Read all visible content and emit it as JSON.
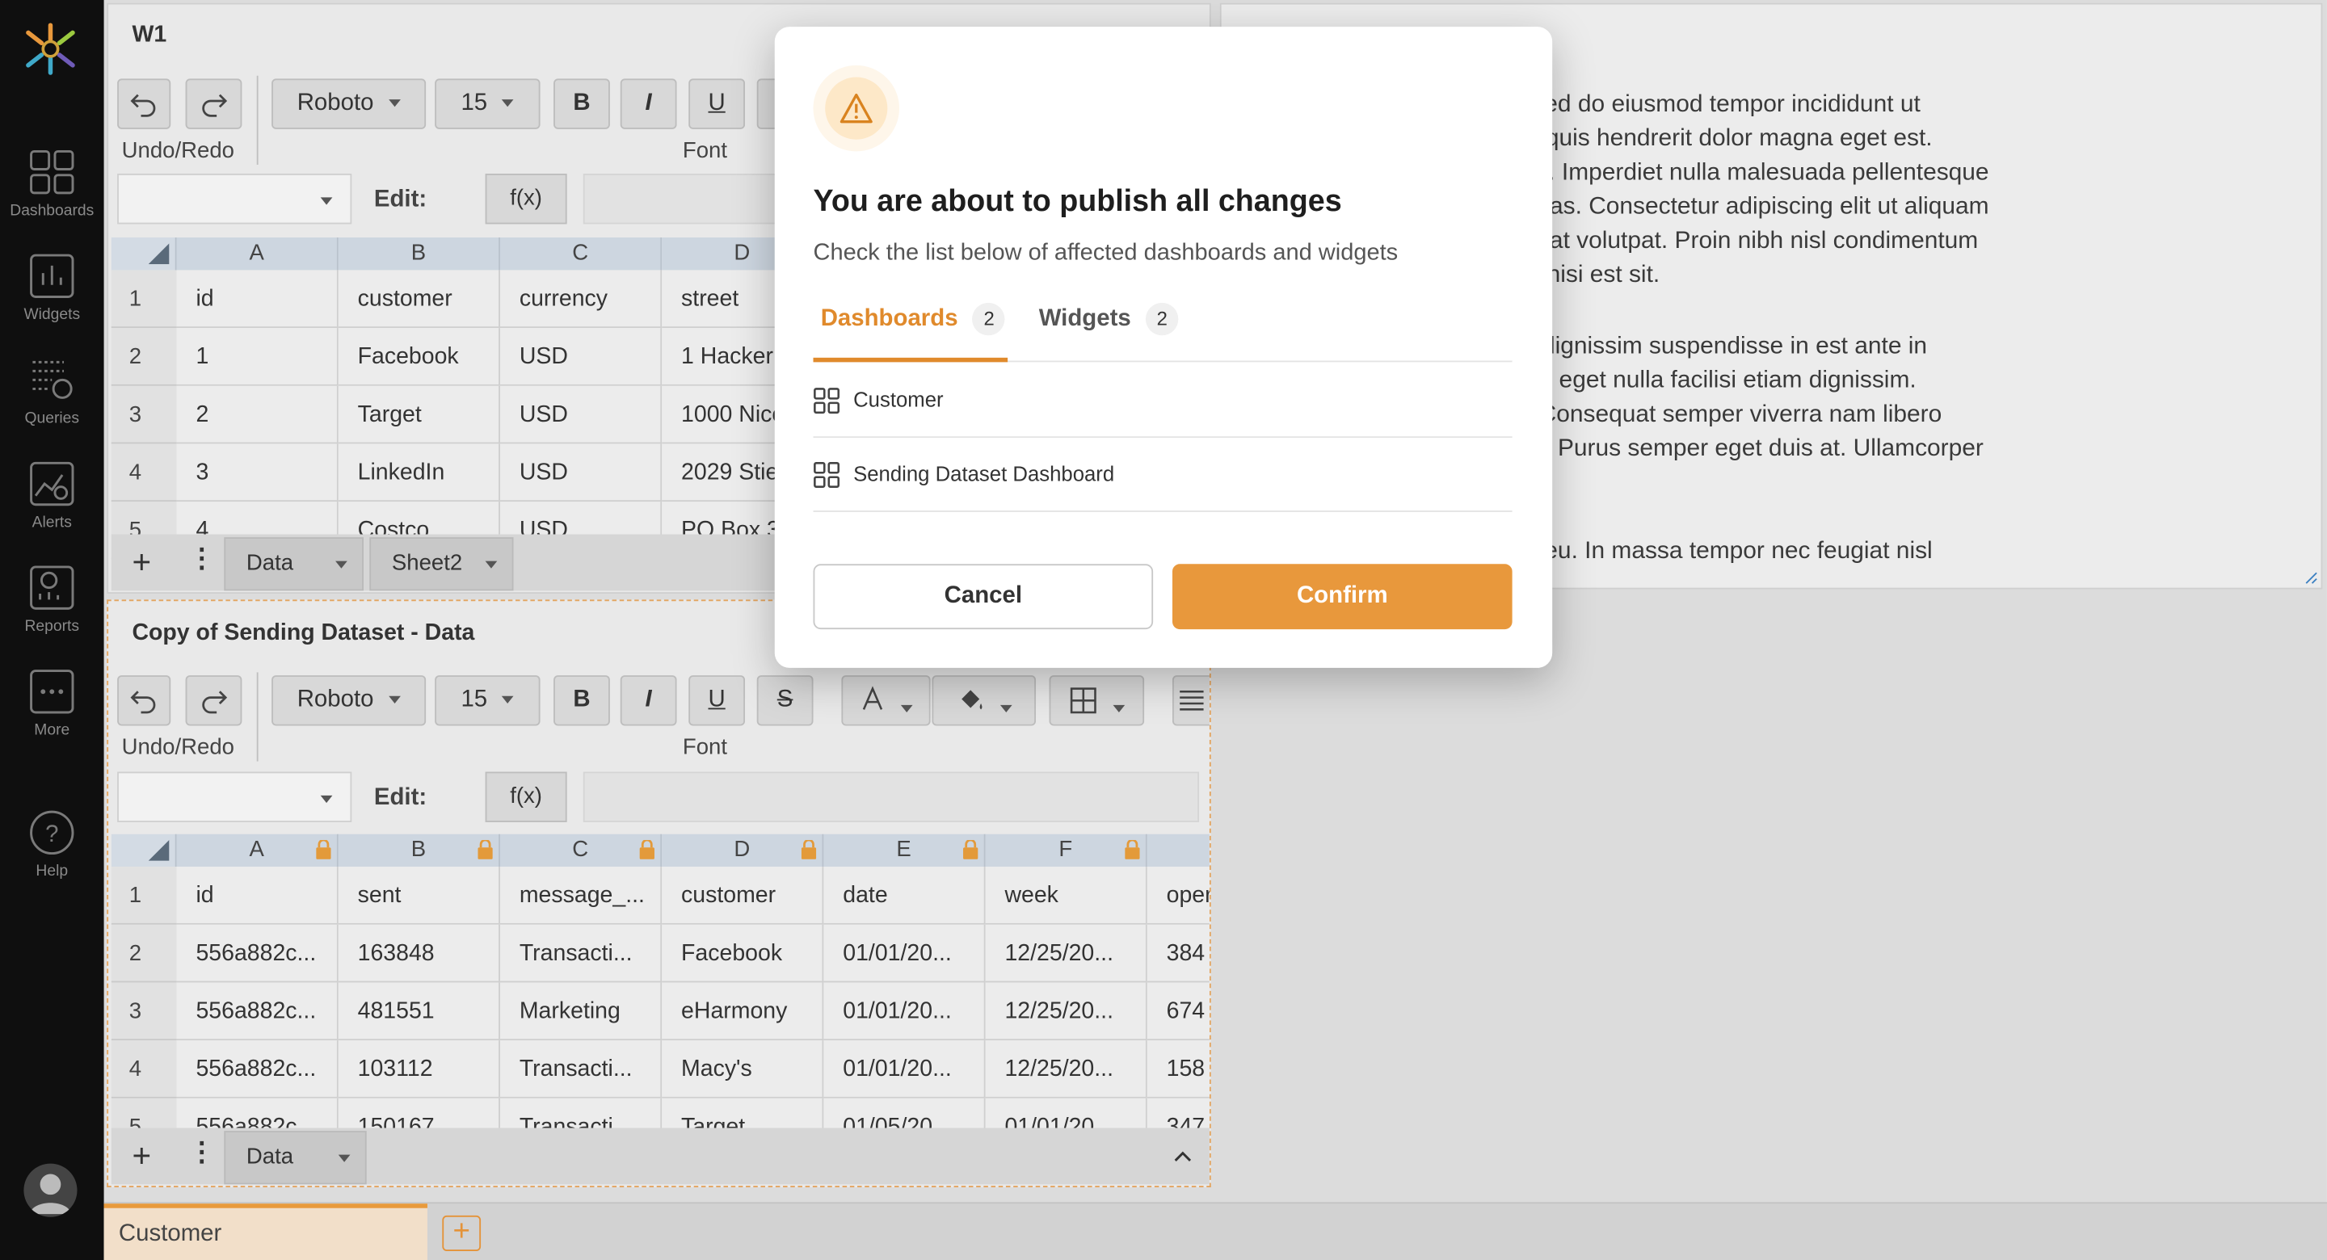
{
  "nav": {
    "items": [
      {
        "label": "Dashboards",
        "icon": "dashboards-icon"
      },
      {
        "label": "Widgets",
        "icon": "widgets-icon"
      },
      {
        "label": "Queries",
        "icon": "queries-icon"
      },
      {
        "label": "Alerts",
        "icon": "alerts-icon"
      },
      {
        "label": "Reports",
        "icon": "reports-icon"
      },
      {
        "label": "More",
        "icon": "more-icon"
      },
      {
        "label": "Help",
        "icon": "help-icon"
      }
    ]
  },
  "widget1": {
    "title": "W1",
    "font_name": "Roboto",
    "font_size": "15",
    "bold": "B",
    "italic": "I",
    "underline": "U",
    "undo_redo_label": "Undo/Redo",
    "font_label": "Font",
    "edit_label": "Edit:",
    "fx_label": "f(x)",
    "columns": [
      "A",
      "B",
      "C",
      "D"
    ],
    "rows": [
      {
        "num": "1",
        "cells": [
          "id",
          "customer",
          "currency",
          "street"
        ]
      },
      {
        "num": "2",
        "cells": [
          "1",
          "Facebook",
          "USD",
          "1 Hacker"
        ]
      },
      {
        "num": "3",
        "cells": [
          "2",
          "Target",
          "USD",
          "1000 Nico"
        ]
      },
      {
        "num": "4",
        "cells": [
          "3",
          "LinkedIn",
          "USD",
          "2029 Stie"
        ]
      },
      {
        "num": "5",
        "cells": [
          "4",
          "Costco",
          "USD",
          "PO Box 3"
        ]
      }
    ],
    "sheets": [
      "Data",
      "Sheet2"
    ]
  },
  "widget2": {
    "title": "Copy of Sending Dataset - Data",
    "font_name": "Roboto",
    "font_size": "15",
    "bold": "B",
    "italic": "I",
    "underline": "U",
    "strike": "S",
    "undo_redo_label": "Undo/Redo",
    "font_label": "Font",
    "edit_label": "Edit:",
    "fx_label": "f(x)",
    "columns": [
      "A",
      "B",
      "C",
      "D",
      "E",
      "F"
    ],
    "rows": [
      {
        "num": "1",
        "cells": [
          "id",
          "sent",
          "message_...",
          "customer",
          "date",
          "week",
          "oper"
        ]
      },
      {
        "num": "2",
        "cells": [
          "556a882c...",
          "163848",
          "Transacti...",
          "Facebook",
          "01/01/20...",
          "12/25/20...",
          "384"
        ]
      },
      {
        "num": "3",
        "cells": [
          "556a882c...",
          "481551",
          "Marketing",
          "eHarmony",
          "01/01/20...",
          "12/25/20...",
          "674"
        ]
      },
      {
        "num": "4",
        "cells": [
          "556a882c...",
          "103112",
          "Transacti...",
          "Macy's",
          "01/01/20...",
          "12/25/20...",
          "158"
        ]
      },
      {
        "num": "5",
        "cells": [
          "556a882c...",
          "150167",
          "Transacti...",
          "Target",
          "01/05/20...",
          "01/01/20...",
          "347"
        ]
      }
    ],
    "sheets": [
      "Data"
    ]
  },
  "text_widget": {
    "paragraphs": [
      "consectetur adipiscing elit, sed do eiusmod tempor incididunt ut\na. Massa massa ultricies mi quis hendrerit dolor magna eget est.\nras adipiscing enim eu turpis. Imperdiet nulla malesuada pellentesque\nunt ornare massa eget egestas. Consectetur adipiscing elit ut aliquam\ntis. Semper quis lectus nulla at volutpat. Proin nibh nisl condimentum\nus viverra vitae. Nullam non nisi est sit.",
      "scing at in. Quam vulputate dignissim suspendisse in est ante in\ntincidunt ornare. Ullamcorper eget nulla facilisi etiam dignissim.\nrper morbi tincidunt ornare. Consequat semper viverra nam libero\nllentesque eu tincidunt tortor. Purus semper eget duis at. Ullamcorper\nis.",
      "s rutrum tellus pellentesque eu. In massa tempor nec feugiat nisl"
    ]
  },
  "dashboard_tabs": {
    "active": "Customer"
  },
  "modal": {
    "title": "You are about to publish all changes",
    "subtitle": "Check the list below of affected dashboards and widgets",
    "tabs": [
      {
        "label": "Dashboards",
        "count": "2"
      },
      {
        "label": "Widgets",
        "count": "2"
      }
    ],
    "items": [
      "Customer",
      "Sending Dataset Dashboard"
    ],
    "cancel_label": "Cancel",
    "confirm_label": "Confirm"
  },
  "colors": {
    "accent": "#e8983c",
    "nav_bg": "#0f0f0f",
    "active_tab": "#e08a2c"
  }
}
